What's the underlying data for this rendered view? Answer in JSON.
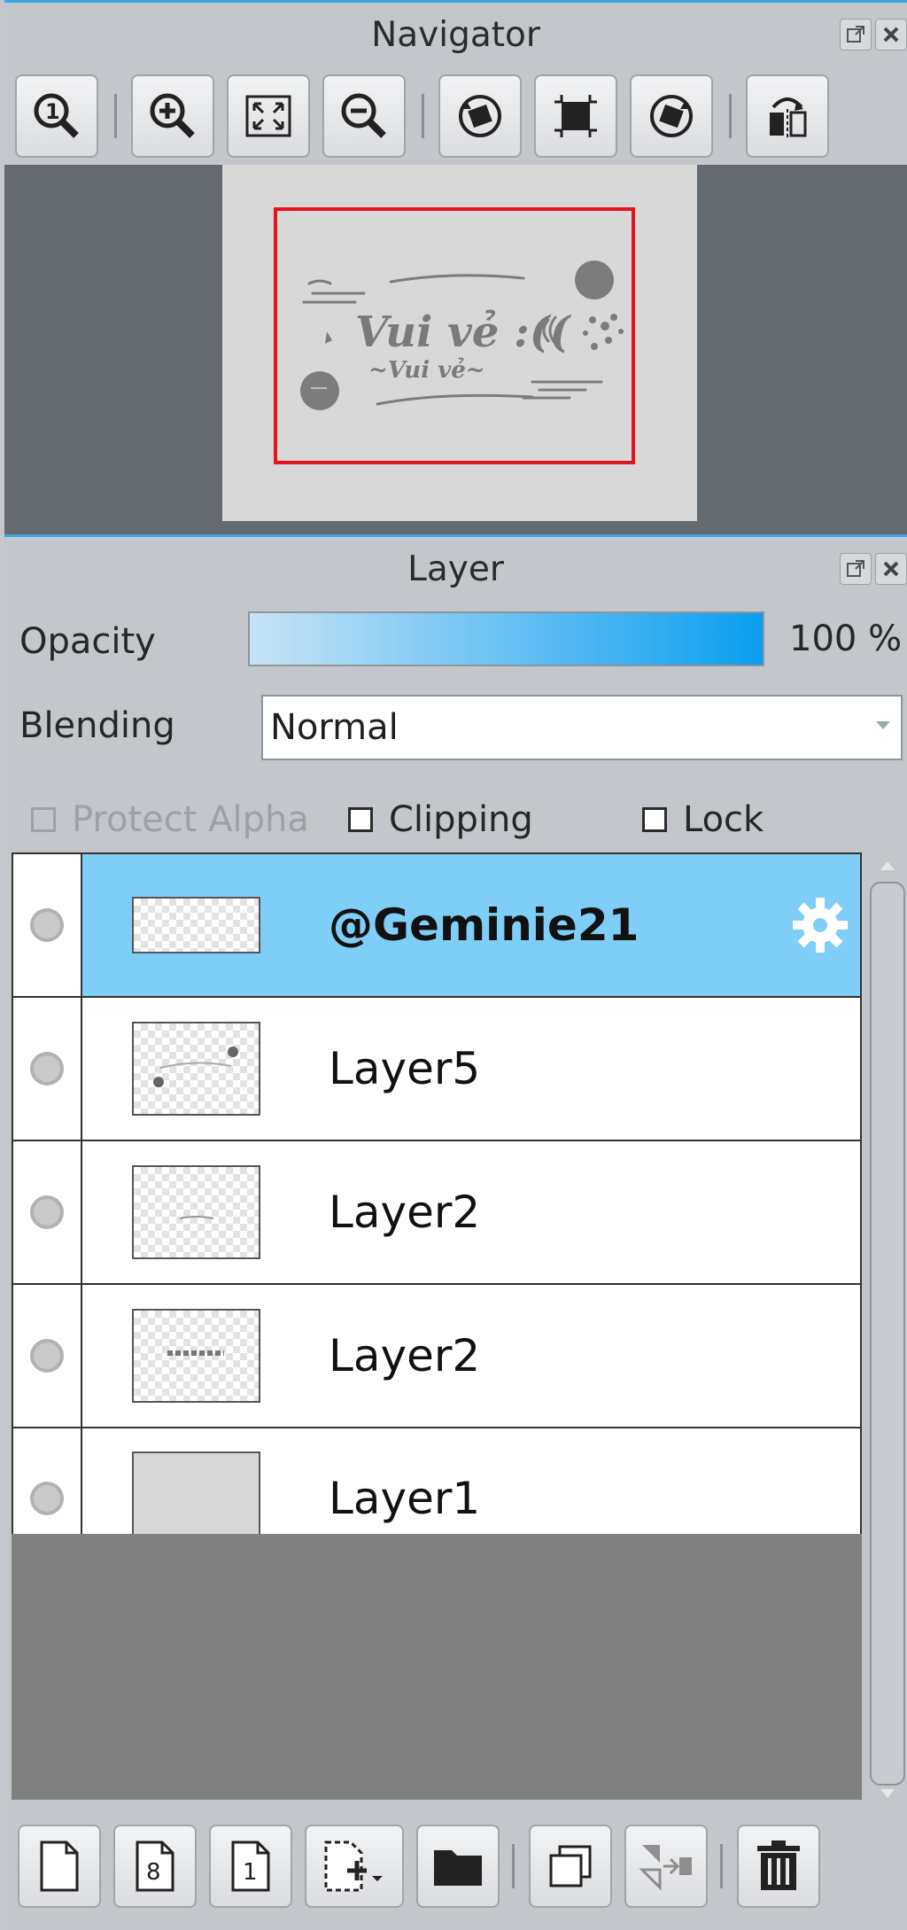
{
  "navigator": {
    "title": "Navigator",
    "toolbar": [
      "zoom-100-icon",
      "zoom-in-icon",
      "fit-screen-icon",
      "zoom-out-icon",
      "rotate-left-icon",
      "reset-rotation-icon",
      "rotate-right-icon",
      "flip-horizontal-icon"
    ],
    "preview": {
      "main_text": "Vui vẻ :((",
      "sub_text": "~Vui vẻ~"
    }
  },
  "layer_panel": {
    "title": "Layer",
    "opacity_label": "Opacity",
    "opacity_value": "100 %",
    "opacity_level": 1.0,
    "blending_label": "Blending",
    "blending_value": "Normal",
    "protect_alpha_label": "Protect Alpha",
    "clipping_label": "Clipping",
    "lock_label": "Lock",
    "layers": [
      {
        "name": "@Geminie21",
        "selected": true
      },
      {
        "name": "Layer5",
        "selected": false
      },
      {
        "name": "Layer2",
        "selected": false
      },
      {
        "name": "Layer2",
        "selected": false
      },
      {
        "name": "Layer1",
        "selected": false
      }
    ],
    "bottom_toolbar": [
      "new-layer-icon",
      "new-8bit-layer-icon",
      "new-1bit-layer-icon",
      "add-layer-menu-icon",
      "new-folder-icon",
      "duplicate-layer-icon",
      "merge-down-icon",
      "delete-layer-icon"
    ]
  },
  "colors": {
    "accent": "#37a7e6",
    "selected_row": "#7ecef7",
    "frame": "#e3141b"
  }
}
